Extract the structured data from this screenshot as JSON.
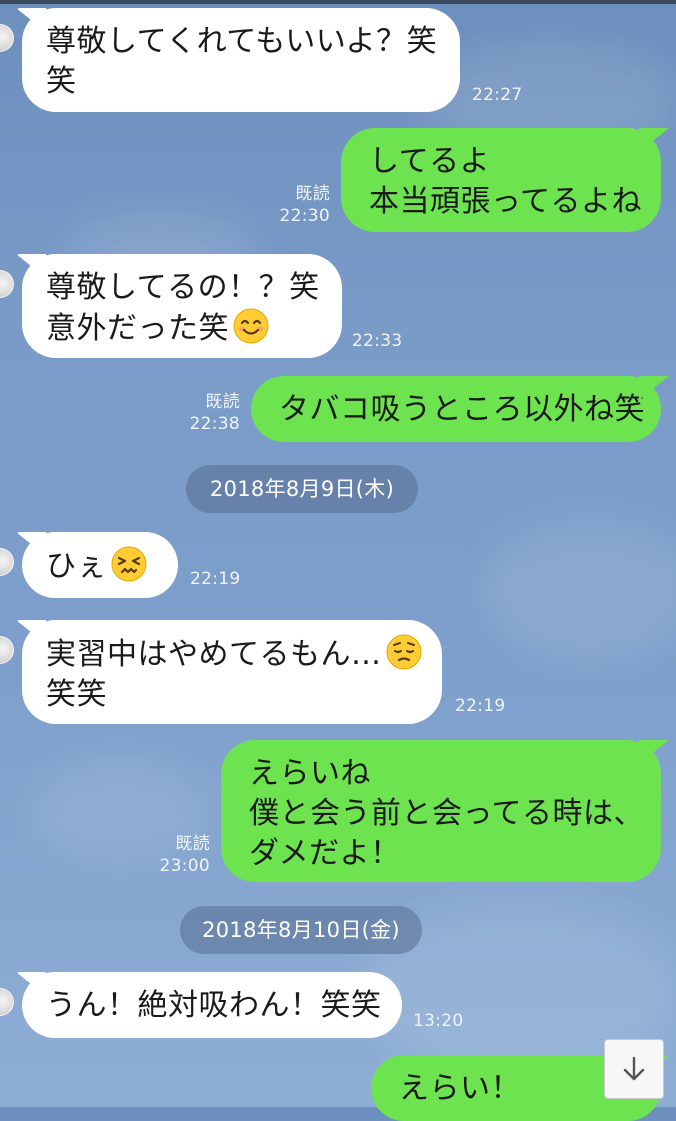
{
  "messages": [
    {
      "dir": "in",
      "lines": [
        "尊敬してくれてもいいよ？笑",
        "笑"
      ],
      "time": "22:27"
    },
    {
      "dir": "out",
      "lines": [
        "してるよ",
        "本当頑張ってるよね"
      ],
      "read": "既読",
      "time": "22:30"
    },
    {
      "dir": "in",
      "lines": [
        "尊敬してるの！？笑",
        "意外だった笑"
      ],
      "emoji": "smiling-face-icon",
      "time": "22:33"
    },
    {
      "dir": "out",
      "lines": [
        "タバコ吸うところ以外ね笑"
      ],
      "read": "既読",
      "time": "22:38"
    },
    {
      "dir": "in",
      "lines": [
        "ひぇ"
      ],
      "emoji": "confounded-face-icon",
      "time": "22:19"
    },
    {
      "dir": "in",
      "lines": [
        "実習中はやめてるもん…",
        "笑笑"
      ],
      "emoji": "pensive-face-icon",
      "time": "22:19"
    },
    {
      "dir": "out",
      "lines": [
        "えらいね",
        "僕と会う前と会ってる時は、",
        "ダメだよ！"
      ],
      "read": "既読",
      "time": "23:00"
    },
    {
      "dir": "in",
      "lines": [
        "うん！絶対吸わん！笑笑"
      ],
      "time": "13:20"
    },
    {
      "dir": "out",
      "lines": [
        "えらい！"
      ]
    }
  ],
  "dates": [
    "2018年8月9日(木)",
    "2018年8月10日(金)"
  ],
  "scroll_button": {
    "icon": "arrow-down-icon"
  },
  "colors": {
    "outgoing_bubble": "#6ee350",
    "incoming_bubble": "#ffffff",
    "background": "#7a9bc8",
    "date_pill": "#4b6282"
  }
}
